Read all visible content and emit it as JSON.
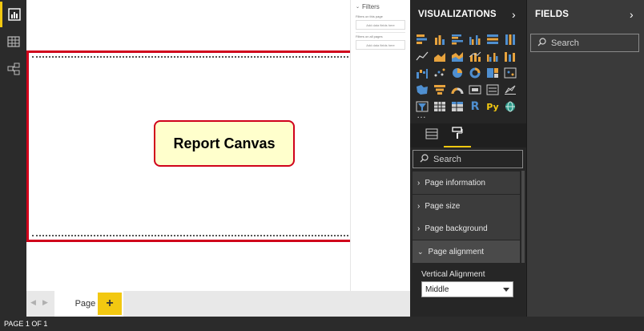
{
  "left_nav": {
    "items": [
      {
        "icon": "report-view-icon",
        "active": true
      },
      {
        "icon": "data-view-icon",
        "active": false
      },
      {
        "icon": "model-view-icon",
        "active": false
      }
    ]
  },
  "canvas": {
    "label": "Report Canvas"
  },
  "filters_pane": {
    "title": "Filters",
    "on_this_page": "Filters on this page",
    "on_this_page_drop": "Add data fields here",
    "on_all_pages": "Filters on all pages",
    "on_all_pages_drop": "Add data fields here"
  },
  "page_tabs": {
    "tabs": [
      "Page 1"
    ],
    "add_label": "+"
  },
  "status_bar": {
    "text": "PAGE 1 OF 1"
  },
  "visualizations": {
    "title": "VISUALIZATIONS",
    "more_label": "…",
    "visual_icons": [
      "stacked-bar-icon",
      "stacked-column-icon",
      "clustered-bar-icon",
      "clustered-column-icon",
      "100-bar-icon",
      "100-column-icon",
      "line-chart-icon",
      "area-chart-icon",
      "stacked-area-icon",
      "line-column-icon",
      "line-clustered-icon",
      "ribbon-chart-icon",
      "waterfall-icon",
      "scatter-icon",
      "pie-chart-icon",
      "donut-chart-icon",
      "treemap-icon",
      "map-icon",
      "filled-map-icon",
      "funnel-icon",
      "gauge-icon",
      "card-icon",
      "multirow-card-icon",
      "kpi-icon",
      "slicer-icon",
      "table-icon",
      "matrix-icon",
      "r-visual-icon",
      "python-visual-icon",
      "globe-icon"
    ],
    "r_label": "R",
    "py_label": "Py",
    "search_placeholder": "Search",
    "sections": [
      {
        "label": "Page information",
        "open": false
      },
      {
        "label": "Page size",
        "open": false
      },
      {
        "label": "Page background",
        "open": false
      },
      {
        "label": "Page alignment",
        "open": true
      }
    ],
    "vertical_alignment": {
      "label": "Vertical Alignment",
      "value": "Middle"
    }
  },
  "fields": {
    "title": "FIELDS",
    "search_placeholder": "Search"
  },
  "colors": {
    "accent": "#f2c811",
    "highlight": "#d0021b",
    "label_bg": "#ffffcc"
  }
}
